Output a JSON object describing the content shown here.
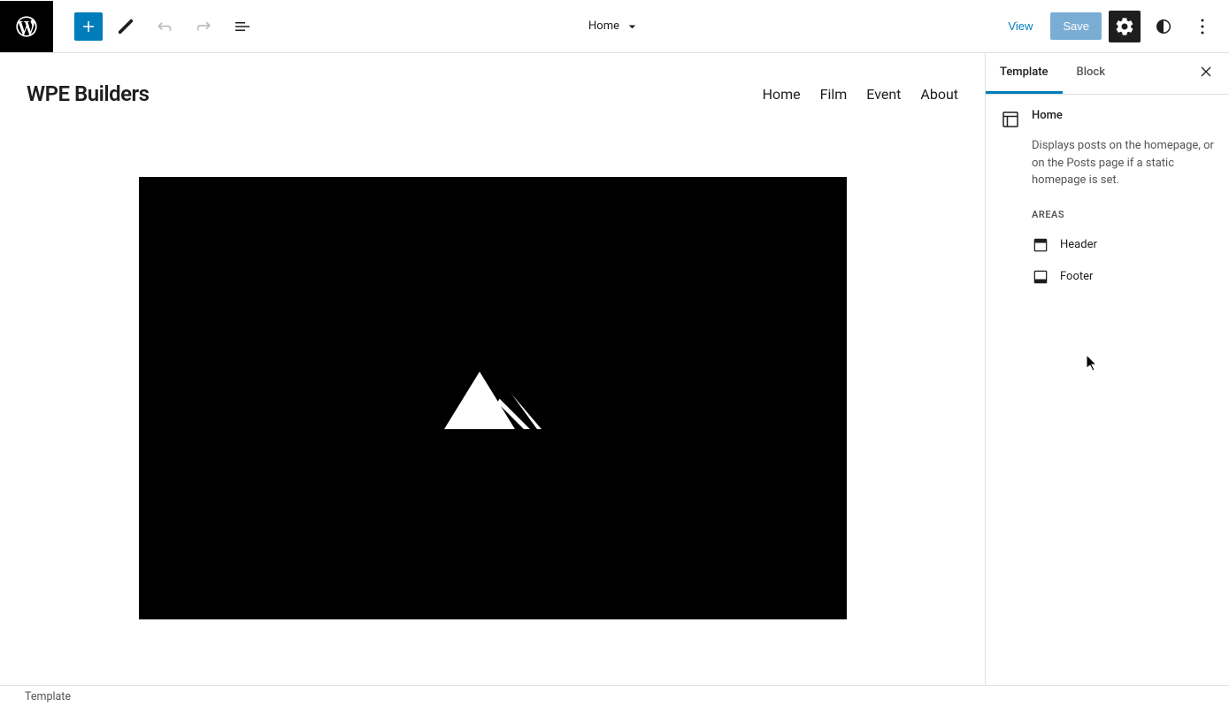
{
  "toolbar": {
    "document_title": "Home",
    "view_label": "View",
    "save_label": "Save"
  },
  "site": {
    "title": "WPE Builders",
    "nav": [
      "Home",
      "Film",
      "Event",
      "About"
    ]
  },
  "sidebar": {
    "tabs": {
      "template": "Template",
      "block": "Block"
    },
    "template": {
      "name": "Home",
      "description": "Displays posts on the homepage, or on the Posts page if a static homepage is set.",
      "areas_label": "Areas",
      "areas": [
        "Header",
        "Footer"
      ]
    }
  },
  "breadcrumb": {
    "label": "Template"
  }
}
